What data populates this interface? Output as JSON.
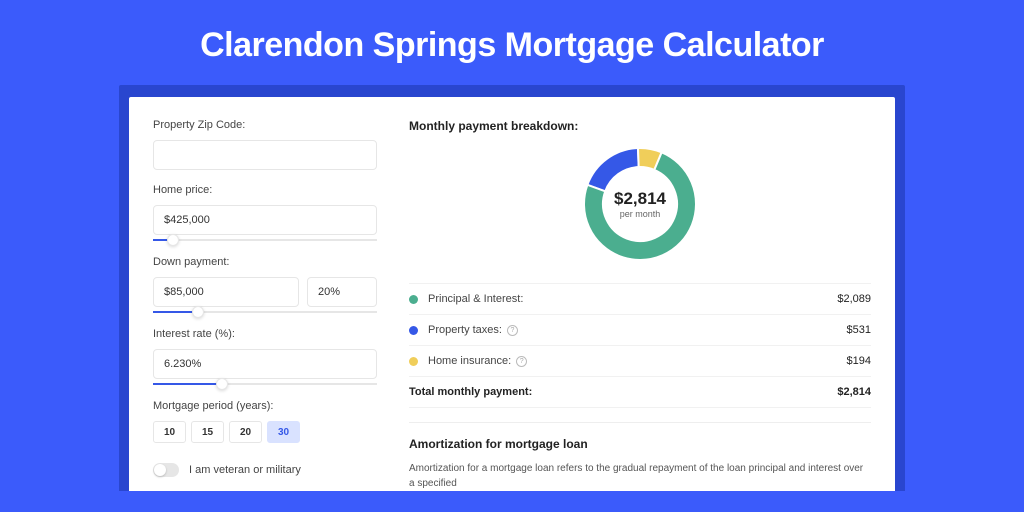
{
  "title": "Clarendon Springs Mortgage Calculator",
  "colors": {
    "principal": "#4BAE8F",
    "taxes": "#3558E7",
    "insurance": "#F0CE5A"
  },
  "form": {
    "zip_label": "Property Zip Code:",
    "zip_value": "",
    "price_label": "Home price:",
    "price_value": "$425,000",
    "down_label": "Down payment:",
    "down_value": "$85,000",
    "down_pct": "20%",
    "rate_label": "Interest rate (%):",
    "rate_value": "6.230%",
    "period_label": "Mortgage period (years):",
    "periods": [
      "10",
      "15",
      "20",
      "30"
    ],
    "period_active_index": 3,
    "veteran_label": "I am veteran or military"
  },
  "breakdown": {
    "title": "Monthly payment breakdown:",
    "center_amount": "$2,814",
    "center_sub": "per month",
    "items": [
      {
        "label": "Principal & Interest:",
        "value": "$2,089",
        "color": "principal",
        "info": false,
        "num": 2089
      },
      {
        "label": "Property taxes:",
        "value": "$531",
        "color": "taxes",
        "info": true,
        "num": 531
      },
      {
        "label": "Home insurance:",
        "value": "$194",
        "color": "insurance",
        "info": true,
        "num": 194
      }
    ],
    "total_label": "Total monthly payment:",
    "total_value": "$2,814"
  },
  "amort": {
    "title": "Amortization for mortgage loan",
    "text": "Amortization for a mortgage loan refers to the gradual repayment of the loan principal and interest over a specified"
  },
  "chart_data": {
    "type": "pie",
    "title": "Monthly payment breakdown",
    "categories": [
      "Principal & Interest",
      "Property taxes",
      "Home insurance"
    ],
    "values": [
      2089,
      531,
      194
    ],
    "total": 2814
  }
}
